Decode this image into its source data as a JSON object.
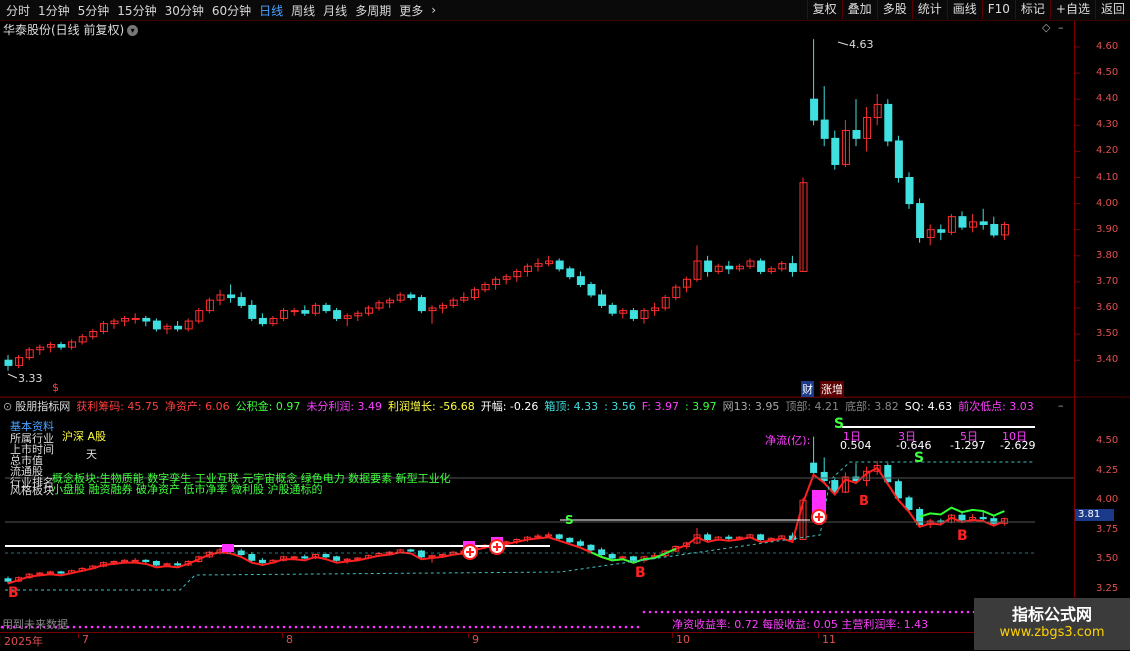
{
  "toolbar": {
    "periods": [
      "分时",
      "1分钟",
      "5分钟",
      "15分钟",
      "30分钟",
      "60分钟",
      "日线",
      "周线",
      "月线",
      "多周期",
      "更多"
    ],
    "active_period": "日线",
    "right_buttons": [
      "复权",
      "叠加",
      "多股",
      "统计",
      "画线",
      "F10",
      "标记",
      "+自选",
      "返回"
    ]
  },
  "main_title": "华泰股份(日线 前复权)",
  "price_axis": [
    "4.60",
    "4.50",
    "4.40",
    "4.30",
    "4.20",
    "4.10",
    "4.00",
    "3.90",
    "3.80",
    "3.70",
    "3.60",
    "3.50",
    "3.40"
  ],
  "high_label": "4.63",
  "low_label": "3.33",
  "marks": {
    "cai": "财",
    "zhang": "涨增"
  },
  "indicator_bar": {
    "name": "股朋指标网",
    "items": [
      {
        "label": "获利筹码: 45.75",
        "color": "#ff4040"
      },
      {
        "label": "净资产: 6.06",
        "color": "#ff4040"
      },
      {
        "label": "公积金: 0.97",
        "color": "#40ff40"
      },
      {
        "label": "未分利润: 3.49",
        "color": "#ff40ff"
      },
      {
        "label": "利润增长: -56.68",
        "color": "#ffff40"
      },
      {
        "label": "开幅: -0.26",
        "color": "#ffffff"
      },
      {
        "label": "箱顶: 4.33",
        "color": "#40e0e0"
      },
      {
        "label": ": 3.56",
        "color": "#40e0e0"
      },
      {
        "label": "F: 3.97",
        "color": "#ff40ff"
      },
      {
        "label": ": 3.97",
        "color": "#40ff40"
      },
      {
        "label": "网13: 3.95",
        "color": "#aaaaaa"
      },
      {
        "label": "顶部: 4.21",
        "color": "#888888"
      },
      {
        "label": "底部: 3.82",
        "color": "#888888"
      },
      {
        "label": "SQ: 4.63",
        "color": "#ffffff"
      },
      {
        "label": "前次低点: 3.03",
        "color": "#ff40ff"
      }
    ]
  },
  "lower_axis": [
    "4.50",
    "4.25",
    "4.00",
    "3.75",
    "3.50",
    "3.25"
  ],
  "current_price": "3.81",
  "overlays": {
    "jibenziliao": "基本资料",
    "a_share": "沪深 A股",
    "rows": [
      "所属行业",
      "上市时间",
      "总市值",
      "流通股",
      "行业排名",
      "风格板块"
    ],
    "tail": "天",
    "concept": "概念板块:生物质能 数字孪生 工业互联 元宇宙概念 绿色电力 数据要素 新型工业化",
    "style": "小盘股 融资融券 破净资产 低市净率 微利股 沪股通标的",
    "netflow_label": "净流(亿):",
    "netflow_periods": [
      "1日",
      "3日",
      "5日",
      "10日"
    ],
    "netflow_values": [
      "0.504",
      "-0.646",
      "-1.297",
      "-2.629"
    ],
    "bottom_text": "净资收益率: 0.72 每股收益: 0.05 主营利润率: 1.43",
    "bottom_left": "用到未来数据"
  },
  "signals": {
    "b": "B",
    "s": "S"
  },
  "dates": [
    "2025年",
    "7",
    "8",
    "9",
    "10",
    "11"
  ],
  "logo": {
    "line1": "指标公式网",
    "line2": "www.zbgs3.com"
  },
  "chart_data": {
    "type": "candlestick",
    "title": "华泰股份(日线 前复权)",
    "ylim": [
      3.33,
      4.63
    ],
    "x_months": [
      "7",
      "8",
      "9",
      "10",
      "11"
    ],
    "high": 4.63,
    "low": 3.33,
    "series": [
      {
        "values": [
          [
            3.4,
            3.42,
            3.36,
            3.38
          ],
          [
            3.38,
            3.42,
            3.37,
            3.41
          ],
          [
            3.41,
            3.45,
            3.4,
            3.44
          ],
          [
            3.44,
            3.46,
            3.42,
            3.45
          ],
          [
            3.45,
            3.47,
            3.43,
            3.46
          ],
          [
            3.46,
            3.47,
            3.44,
            3.45
          ],
          [
            3.45,
            3.48,
            3.44,
            3.47
          ],
          [
            3.47,
            3.5,
            3.46,
            3.49
          ],
          [
            3.49,
            3.52,
            3.48,
            3.51
          ],
          [
            3.51,
            3.55,
            3.5,
            3.54
          ],
          [
            3.54,
            3.56,
            3.52,
            3.55
          ],
          [
            3.55,
            3.57,
            3.53,
            3.56
          ],
          [
            3.56,
            3.58,
            3.54,
            3.56
          ],
          [
            3.56,
            3.57,
            3.53,
            3.55
          ],
          [
            3.55,
            3.56,
            3.51,
            3.52
          ],
          [
            3.52,
            3.54,
            3.5,
            3.53
          ],
          [
            3.53,
            3.55,
            3.51,
            3.52
          ],
          [
            3.52,
            3.56,
            3.51,
            3.55
          ],
          [
            3.55,
            3.6,
            3.54,
            3.59
          ],
          [
            3.59,
            3.64,
            3.58,
            3.63
          ],
          [
            3.63,
            3.67,
            3.61,
            3.65
          ],
          [
            3.65,
            3.69,
            3.62,
            3.64
          ],
          [
            3.64,
            3.66,
            3.6,
            3.61
          ],
          [
            3.61,
            3.63,
            3.55,
            3.56
          ],
          [
            3.56,
            3.58,
            3.53,
            3.54
          ],
          [
            3.54,
            3.57,
            3.53,
            3.56
          ],
          [
            3.56,
            3.6,
            3.55,
            3.59
          ],
          [
            3.59,
            3.6,
            3.57,
            3.59
          ],
          [
            3.59,
            3.61,
            3.57,
            3.58
          ],
          [
            3.58,
            3.62,
            3.57,
            3.61
          ],
          [
            3.61,
            3.62,
            3.58,
            3.59
          ],
          [
            3.59,
            3.6,
            3.55,
            3.56
          ],
          [
            3.56,
            3.58,
            3.53,
            3.57
          ],
          [
            3.57,
            3.59,
            3.55,
            3.58
          ],
          [
            3.58,
            3.61,
            3.57,
            3.6
          ],
          [
            3.6,
            3.63,
            3.59,
            3.62
          ],
          [
            3.62,
            3.64,
            3.6,
            3.63
          ],
          [
            3.63,
            3.66,
            3.62,
            3.65
          ],
          [
            3.65,
            3.66,
            3.63,
            3.64
          ],
          [
            3.64,
            3.65,
            3.58,
            3.59
          ],
          [
            3.59,
            3.61,
            3.54,
            3.6
          ],
          [
            3.6,
            3.62,
            3.58,
            3.61
          ],
          [
            3.61,
            3.64,
            3.6,
            3.63
          ],
          [
            3.63,
            3.66,
            3.62,
            3.64
          ],
          [
            3.64,
            3.68,
            3.63,
            3.67
          ],
          [
            3.67,
            3.7,
            3.66,
            3.69
          ],
          [
            3.69,
            3.72,
            3.67,
            3.71
          ],
          [
            3.71,
            3.73,
            3.69,
            3.72
          ],
          [
            3.72,
            3.75,
            3.7,
            3.74
          ],
          [
            3.74,
            3.77,
            3.72,
            3.76
          ],
          [
            3.76,
            3.79,
            3.74,
            3.77
          ],
          [
            3.77,
            3.8,
            3.76,
            3.78
          ],
          [
            3.78,
            3.79,
            3.74,
            3.75
          ],
          [
            3.75,
            3.76,
            3.71,
            3.72
          ],
          [
            3.72,
            3.74,
            3.68,
            3.69
          ],
          [
            3.69,
            3.7,
            3.64,
            3.65
          ],
          [
            3.65,
            3.67,
            3.6,
            3.61
          ],
          [
            3.61,
            3.62,
            3.57,
            3.58
          ],
          [
            3.58,
            3.6,
            3.56,
            3.59
          ],
          [
            3.59,
            3.6,
            3.55,
            3.56
          ],
          [
            3.56,
            3.6,
            3.54,
            3.59
          ],
          [
            3.59,
            3.62,
            3.57,
            3.6
          ],
          [
            3.6,
            3.65,
            3.59,
            3.64
          ],
          [
            3.64,
            3.69,
            3.63,
            3.68
          ],
          [
            3.68,
            3.72,
            3.66,
            3.71
          ],
          [
            3.71,
            3.84,
            3.7,
            3.78
          ],
          [
            3.78,
            3.8,
            3.72,
            3.74
          ],
          [
            3.74,
            3.77,
            3.73,
            3.76
          ],
          [
            3.76,
            3.78,
            3.73,
            3.75
          ],
          [
            3.75,
            3.77,
            3.74,
            3.76
          ],
          [
            3.76,
            3.79,
            3.75,
            3.78
          ],
          [
            3.78,
            3.79,
            3.73,
            3.74
          ],
          [
            3.74,
            3.76,
            3.73,
            3.75
          ],
          [
            3.75,
            3.78,
            3.74,
            3.77
          ],
          [
            3.77,
            3.8,
            3.72,
            3.74
          ],
          [
            3.74,
            4.1,
            3.74,
            4.08
          ],
          [
            4.4,
            4.63,
            4.3,
            4.32
          ],
          [
            4.32,
            4.45,
            4.22,
            4.25
          ],
          [
            4.25,
            4.28,
            4.13,
            4.15
          ],
          [
            4.15,
            4.32,
            4.14,
            4.28
          ],
          [
            4.28,
            4.4,
            4.22,
            4.25
          ],
          [
            4.25,
            4.37,
            4.2,
            4.33
          ],
          [
            4.33,
            4.42,
            4.3,
            4.38
          ],
          [
            4.38,
            4.4,
            4.22,
            4.24
          ],
          [
            4.24,
            4.26,
            4.08,
            4.1
          ],
          [
            4.1,
            4.12,
            3.98,
            4.0
          ],
          [
            4.0,
            4.02,
            3.85,
            3.87
          ],
          [
            3.87,
            3.92,
            3.84,
            3.9
          ],
          [
            3.9,
            3.92,
            3.86,
            3.89
          ],
          [
            3.89,
            3.96,
            3.88,
            3.95
          ],
          [
            3.95,
            3.97,
            3.9,
            3.91
          ],
          [
            3.91,
            3.96,
            3.89,
            3.93
          ],
          [
            3.93,
            3.98,
            3.9,
            3.92
          ],
          [
            3.92,
            3.95,
            3.87,
            3.88
          ],
          [
            3.88,
            3.93,
            3.86,
            3.92
          ]
        ]
      }
    ]
  }
}
